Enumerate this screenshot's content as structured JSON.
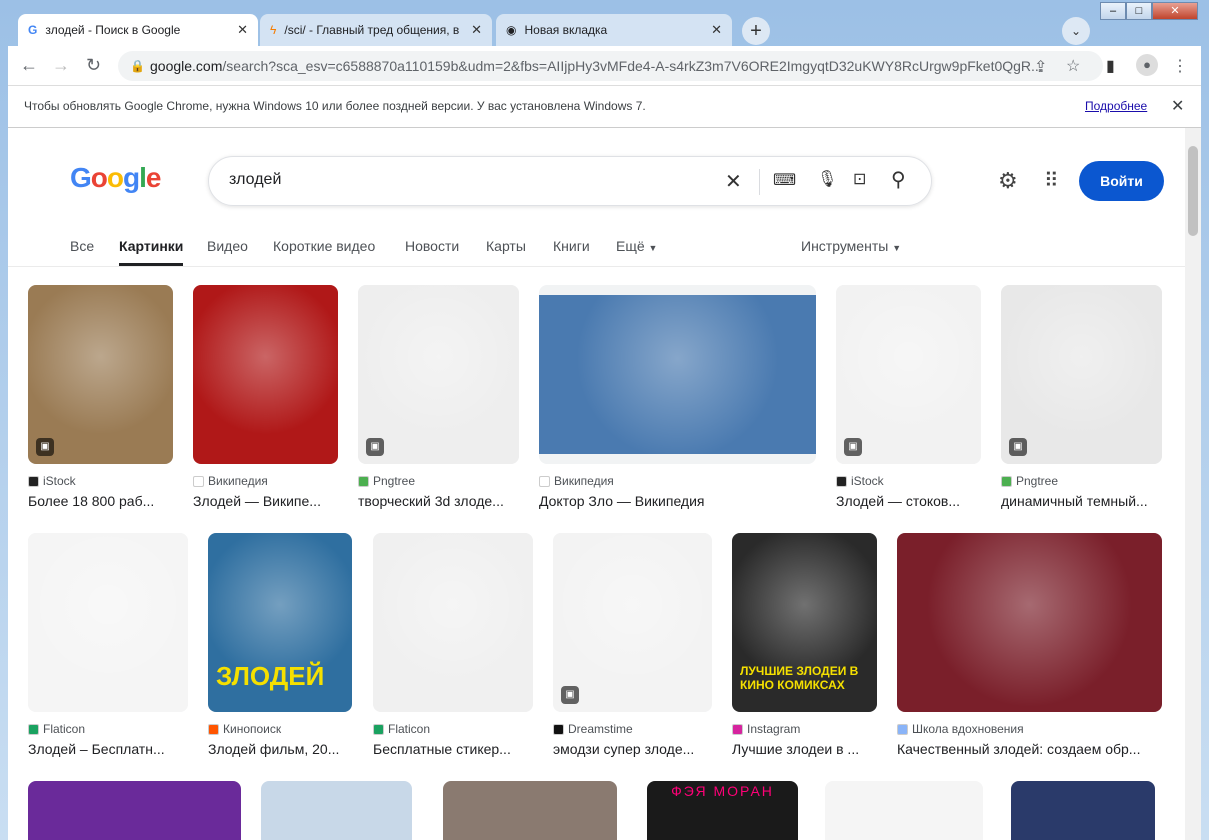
{
  "tabs": [
    {
      "title": "злодей - Поиск в Google",
      "icon": "google-icon"
    },
    {
      "title": "/sci/ - Главный тред общения, в",
      "icon": "lightning-icon"
    },
    {
      "title": "Новая вкладка",
      "icon": "chrome-icon"
    }
  ],
  "address": {
    "domain": "google.com",
    "path": "/search?sca_esv=c6588870a110159b&udm=2&fbs=AIIjpHy3vMFde4-A-s4rkZ3m7V6ORE2ImgyqtD32uKWY8RcUrgw9pFket0QgR..."
  },
  "infobar": {
    "message": "Чтобы обновлять Google Chrome, нужна Windows 10 или более поздней версии. У вас установлена Windows 7.",
    "link": "Подробнее"
  },
  "google": {
    "logo": "Google",
    "query": "злодей",
    "signin": "Войти"
  },
  "nav": {
    "items": [
      "Все",
      "Картинки",
      "Видео",
      "Короткие видео",
      "Новости",
      "Карты",
      "Книги",
      "Ещё"
    ],
    "active": "Картинки",
    "tools": "Инструменты"
  },
  "results": [
    {
      "source": "iStock",
      "title": "Более 18 800 раб...",
      "color": "#9a7b54",
      "fav": "#222"
    },
    {
      "source": "Википедия",
      "title": "Злодей — Википе...",
      "color": "#b01818",
      "fav": "#fff"
    },
    {
      "source": "Pngtree",
      "title": "творческий 3d злоде...",
      "color": "#eeeeee",
      "fav": "#4caf50"
    },
    {
      "source": "Википедия",
      "title": "Доктор Зло — Википедия",
      "color": "#4a7ab0",
      "fav": "#fff"
    },
    {
      "source": "iStock",
      "title": "Злодей — стоков...",
      "color": "#f2f2f2",
      "fav": "#222"
    },
    {
      "source": "Pngtree",
      "title": "динамичный темный...",
      "color": "#e8e8e8",
      "fav": "#4caf50"
    },
    {
      "source": "Flaticon",
      "title": "Злодей – Бесплатн...",
      "color": "#f5f5f5",
      "fav": "#1aa260"
    },
    {
      "source": "Кинопоиск",
      "title": "Злодей фильм, 20...",
      "color": "#2f6fa0",
      "fav": "#ff5500",
      "overlay": "ЗЛОДЕЙ"
    },
    {
      "source": "Flaticon",
      "title": "Бесплатные стикер...",
      "color": "#f0f0f0",
      "fav": "#1aa260"
    },
    {
      "source": "Dreamstime",
      "title": "эмодзи супер злоде...",
      "color": "#f3f3f3",
      "fav": "#111"
    },
    {
      "source": "Instagram",
      "title": "Лучшие злодеи в ...",
      "color": "#2a2a2a",
      "fav": "#d6249f",
      "overlay": "ЛУЧШИЕ ЗЛОДЕИ В КИНО КОМИКСАХ"
    },
    {
      "source": "Школа вдохновения",
      "title": "Качественный злодей: создаем обр...",
      "color": "#7a1f2a",
      "fav": "#8ab4f8"
    }
  ],
  "row3": [
    {
      "color": "#6a2a9a"
    },
    {
      "color": "#c8d8e8"
    },
    {
      "color": "#8a7a70"
    },
    {
      "color": "#1a1a1a",
      "overlay": "ФЭЯ МОРАН"
    },
    {
      "color": "#f5f5f5"
    },
    {
      "color": "#2a3a6a"
    }
  ]
}
